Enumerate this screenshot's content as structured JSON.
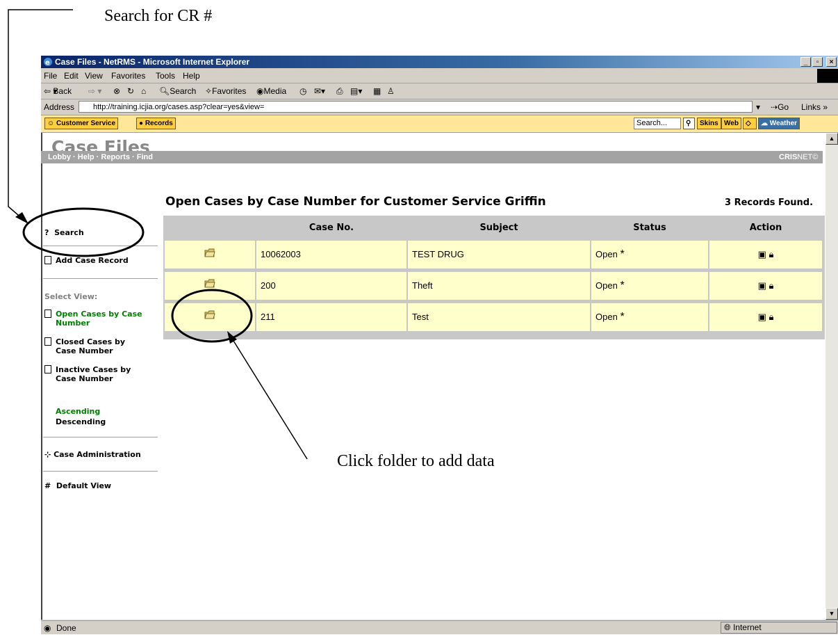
{
  "annotations": {
    "search_callout": "Search for CR #",
    "folder_callout": "Click folder to add data"
  },
  "window": {
    "title": "Case Files - NetRMS - Microsoft Internet Explorer",
    "menu": [
      "File",
      "Edit",
      "View",
      "Favorites",
      "Tools",
      "Help"
    ],
    "toolbar": {
      "back": "Back",
      "search": "Search",
      "favorites": "Favorites",
      "media": "Media"
    },
    "address_label": "Address",
    "url": "http://training.icjia.org/cases.asp?clear=yes&view=",
    "go_label": "Go",
    "links_label": "Links",
    "links_chevron": "»",
    "toolbar2": {
      "customer_service": "Customer Service",
      "records": "Records",
      "search_placeholder": "Search...",
      "skins": "Skins",
      "web": "Web",
      "weather": "Weather"
    },
    "status": {
      "left": "Done",
      "zone": "Internet"
    }
  },
  "page": {
    "app_title": "Case Files",
    "nav_links": "Lobby · Help · Reports · Find",
    "brand": "CRIS",
    "brand_suffix": "NET©",
    "left_nav": {
      "search_prefix": "?",
      "search": "Search",
      "add_case_record": "Add Case Record",
      "select_view_label": "Select View:",
      "views": [
        "Open Cases by Case Number",
        "Closed Cases by Case Number",
        "Inactive Cases by Case Number"
      ],
      "ascending": "Ascending",
      "descending": "Descending",
      "case_admin": "Case Administration",
      "default_view_prefix": "#",
      "default_view": "Default View"
    },
    "heading": "Open Cases by Case Number for Customer Service Griffin",
    "records_found": "3 Records Found.",
    "table": {
      "headers": [
        "Case No.",
        "Subject",
        "Status",
        "Action"
      ],
      "rows": [
        {
          "case_no": "10062003",
          "subject": "TEST DRUG",
          "status": "Open",
          "flag": "*"
        },
        {
          "case_no": "200",
          "subject": "Theft",
          "status": "Open",
          "flag": "*"
        },
        {
          "case_no": "211",
          "subject": "Test",
          "status": "Open",
          "flag": "*"
        }
      ]
    }
  },
  "colors": {
    "title_bar": "#0a246a",
    "toolbar2_bg": "#ffe79a",
    "nav_strip": "#a3a3a3",
    "row_bg": "#ffffcc",
    "active_view": "#008000"
  }
}
